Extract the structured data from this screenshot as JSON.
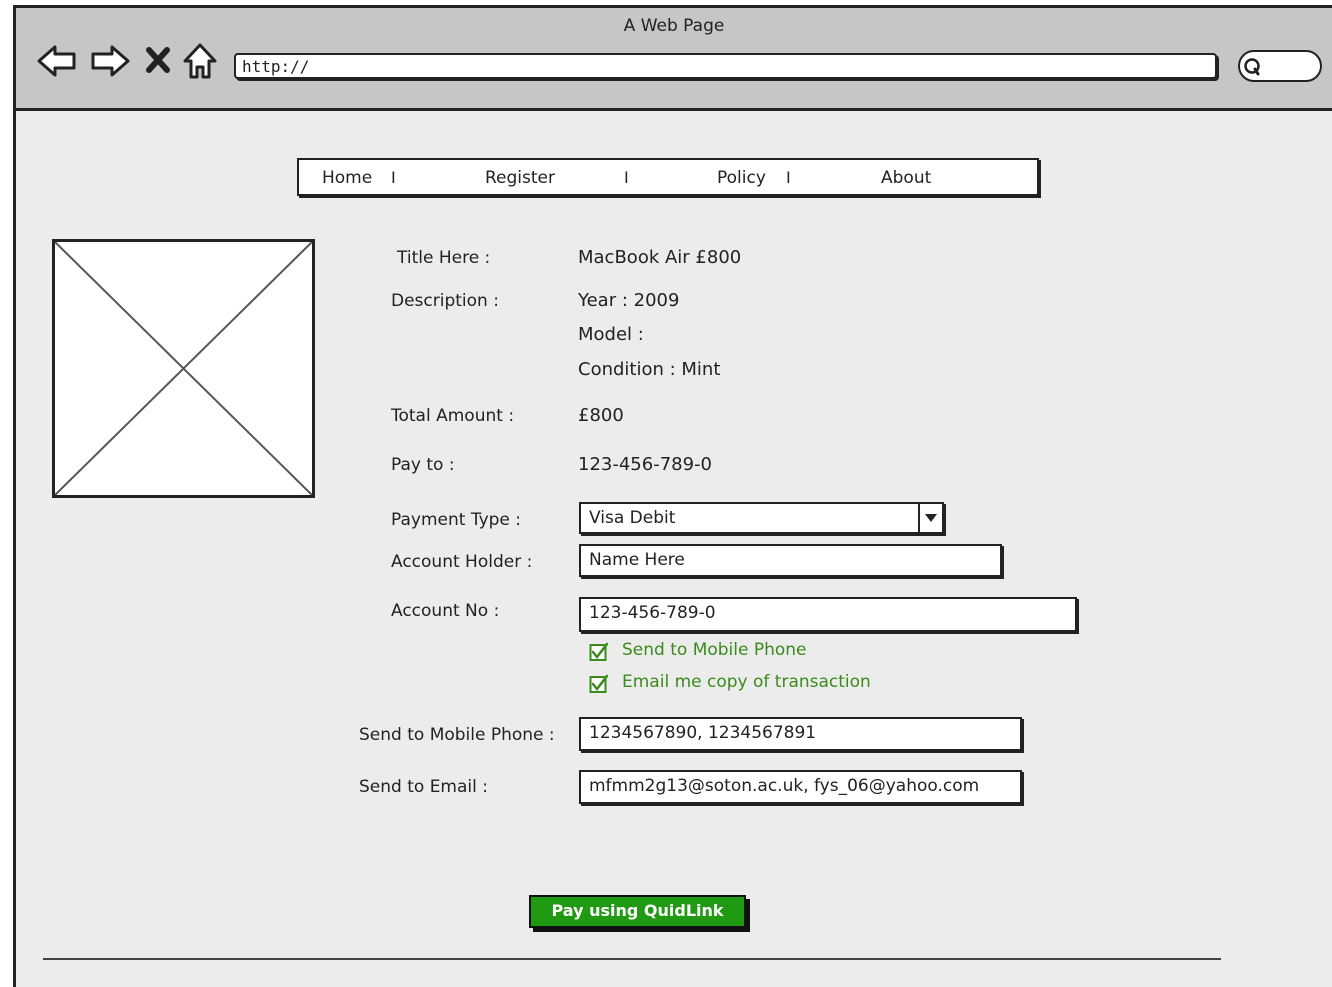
{
  "window": {
    "title": "A Web Page"
  },
  "toolbar": {
    "url": "http://"
  },
  "icons": {
    "back": "back-arrow-icon",
    "forward": "forward-arrow-icon",
    "stop": "close-icon",
    "home": "home-icon",
    "search": "search-icon",
    "image": "image-placeholder-icon",
    "check": "checkbox-checked-icon",
    "dropdown": "chevron-down-icon"
  },
  "nav": {
    "items": [
      {
        "label": "Home"
      },
      {
        "label": "Register"
      },
      {
        "label": "Policy"
      },
      {
        "label": "About"
      }
    ],
    "separator": "I"
  },
  "listing": {
    "title_label": "Title Here  :",
    "title_value": "MacBook Air £800",
    "description_label": "Description  :",
    "year": "Year : 2009",
    "model": "Model :",
    "condition": "Condition : Mint",
    "total_label": "Total Amount  :",
    "total_value": "£800",
    "payto_label": "Pay to  :",
    "payto_value": "123-456-789-0"
  },
  "form": {
    "payment_type_label": "Payment Type  :",
    "payment_type_value": "Visa Debit",
    "holder_label": "Account Holder  :",
    "holder_value": "Name Here",
    "account_label": "Account No  :",
    "account_value": "123-456-789-0",
    "check_mobile": "Send to Mobile Phone",
    "check_email": "Email me copy of transaction",
    "mobile_label": "Send to Mobile Phone  :",
    "mobile_value": "1234567890, 1234567891",
    "email_label": "Send to Email  :",
    "email_value": "mfmm2g13@soton.ac.uk, fys_06@yahoo.com",
    "submit": "Pay using QuidLink"
  },
  "colors": {
    "accent_green": "#1f9a12",
    "checkbox_green": "#3a8a1c",
    "chrome_gray": "#c6c6c6",
    "page_bg": "#ececec"
  }
}
